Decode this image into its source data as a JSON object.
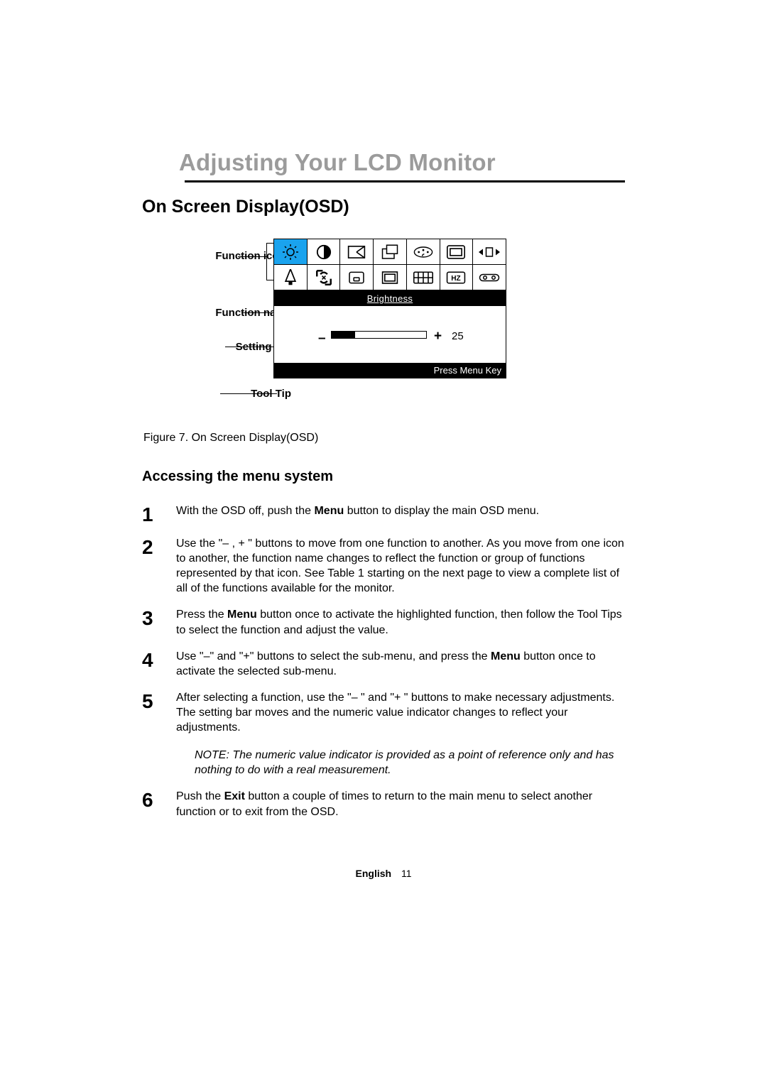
{
  "chapter_title": "Adjusting Your LCD Monitor",
  "section_title": "On Screen Display(OSD)",
  "osd_labels": {
    "icons": "Function icons",
    "fname": "Function name",
    "bar": "Setting bar",
    "tip": "Tool Tip"
  },
  "osd": {
    "function_name": "Brightness",
    "minus": "–",
    "plus": "+",
    "value": "25",
    "tooltip": "Press Menu Key"
  },
  "figure_caption": "Figure 7.  On Screen Display(OSD)",
  "subheading": "Accessing the menu system",
  "steps": {
    "1": {
      "n": "1",
      "html": "With the OSD off, push the <b>Menu</b> button to display the main OSD menu."
    },
    "2": {
      "n": "2",
      "html": "Use the \"– , + \" buttons to move from one function to another. As you move from one icon to another, the function name changes to reflect the function or group of functions represented by that icon. See Table 1 starting on the next page to view a complete list of all of the functions available for the monitor."
    },
    "3": {
      "n": "3",
      "html": "Press the <b>Menu</b> button once to activate the highlighted function, then follow the Tool Tips to select the function and adjust the value."
    },
    "4": {
      "n": "4",
      "html": "Use \"–\"  and \"+\" buttons to select the sub-menu,  and press the <b>Menu</b> button once to activate the selected sub-menu."
    },
    "5": {
      "n": "5",
      "html": "After selecting a function, use the \"– \" and \"+ \" buttons to make necessary adjustments. The setting bar moves and the numeric value indicator changes to reflect your adjustments.",
      "note": "NOTE: The numeric value indicator is provided as a point of reference only and has nothing to do with a real measurement."
    },
    "6": {
      "n": "6",
      "html": "Push the <b>Exit</b> button a couple of times to return to the main menu to select another function or to exit from the OSD."
    }
  },
  "footer_lang": "English",
  "footer_page": "11"
}
